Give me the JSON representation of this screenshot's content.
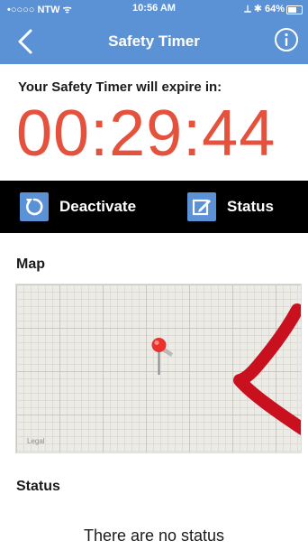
{
  "status_bar": {
    "carrier": "•○○○○ NTW ᯤ",
    "time": "10:56 AM",
    "right": "⟂ ✱ 64%",
    "battery_level": 0.64
  },
  "nav": {
    "title": "Safety Timer",
    "back_icon": "chevron-left-icon",
    "info_icon": "info-circle-icon"
  },
  "timer": {
    "label": "Your Safety Timer will expire in:",
    "value": "00:29:44"
  },
  "actions": {
    "deactivate_label": "Deactivate",
    "deactivate_icon": "refresh-icon",
    "status_label": "Status",
    "status_icon": "edit-icon"
  },
  "map": {
    "title": "Map",
    "legal": "Legal"
  },
  "status": {
    "title": "Status",
    "empty_text": "There are no status"
  },
  "colors": {
    "accent": "#5b92d6",
    "timer": "#e4513c",
    "annotation": "#c8101e"
  }
}
